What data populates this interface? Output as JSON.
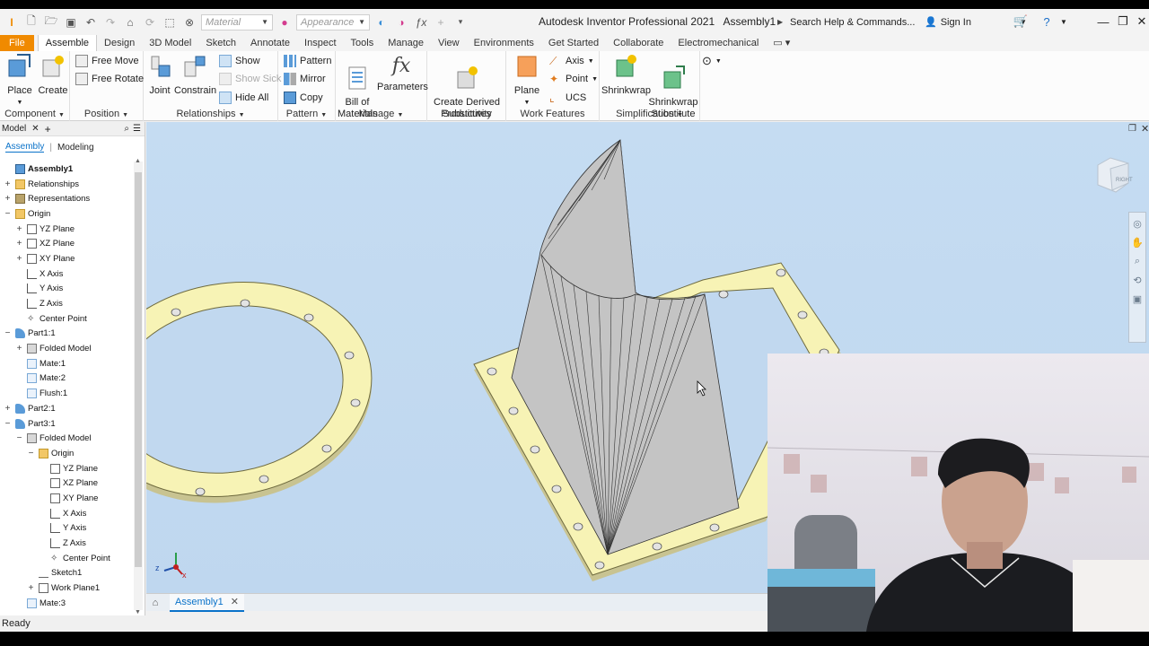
{
  "app": {
    "title": "Autodesk Inventor Professional 2021",
    "document": "Assembly1"
  },
  "qat": {
    "material_placeholder": "Material",
    "appearance_placeholder": "Appearance"
  },
  "search": {
    "placeholder": "Search Help & Commands..."
  },
  "account": {
    "sign_in": "Sign In"
  },
  "menu_tabs": [
    "File",
    "Assemble",
    "Design",
    "3D Model",
    "Sketch",
    "Annotate",
    "Inspect",
    "Tools",
    "Manage",
    "View",
    "Environments",
    "Get Started",
    "Collaborate",
    "Electromechanical"
  ],
  "ribbon": {
    "component": {
      "title": "Component",
      "place": "Place",
      "create": "Create"
    },
    "position": {
      "title": "Position",
      "free_move": "Free Move",
      "free_rotate": "Free Rotate"
    },
    "relationships": {
      "title": "Relationships",
      "joint": "Joint",
      "constrain": "Constrain",
      "show": "Show",
      "show_sick": "Show Sick",
      "hide_all": "Hide All"
    },
    "pattern": {
      "title": "Pattern",
      "pattern": "Pattern",
      "mirror": "Mirror",
      "copy": "Copy"
    },
    "manage": {
      "title": "Manage",
      "bom": "Bill of\nMaterials",
      "parameters": "Parameters"
    },
    "productivity": {
      "title": "Productivity",
      "derived": "Create Derived\nSubstitutes"
    },
    "work_features": {
      "title": "Work Features",
      "plane": "Plane",
      "axis": "Axis",
      "point": "Point",
      "ucs": "UCS"
    },
    "simplification": {
      "title": "Simplification",
      "shrinkwrap": "Shrinkwrap",
      "shrinkwrap_sub": "Shrinkwrap\nSubstitute"
    }
  },
  "browser": {
    "header": "Model",
    "tabs": [
      "Assembly",
      "Modeling"
    ],
    "tree": [
      {
        "label": "Assembly1",
        "level": 0,
        "pm": "",
        "icon": "assembly-icon",
        "bold": true
      },
      {
        "label": "Relationships",
        "level": 0,
        "pm": "+",
        "icon": "folder-icon"
      },
      {
        "label": "Representations",
        "level": 0,
        "pm": "+",
        "icon": "representations-icon"
      },
      {
        "label": "Origin",
        "level": 0,
        "pm": "−",
        "icon": "folder-icon"
      },
      {
        "label": "YZ Plane",
        "level": 1,
        "pm": "+",
        "icon": "plane-icon"
      },
      {
        "label": "XZ Plane",
        "level": 1,
        "pm": "+",
        "icon": "plane-icon"
      },
      {
        "label": "XY Plane",
        "level": 1,
        "pm": "+",
        "icon": "plane-icon"
      },
      {
        "label": "X Axis",
        "level": 1,
        "pm": "",
        "icon": "axis-icon"
      },
      {
        "label": "Y Axis",
        "level": 1,
        "pm": "",
        "icon": "axis-icon"
      },
      {
        "label": "Z Axis",
        "level": 1,
        "pm": "",
        "icon": "axis-icon"
      },
      {
        "label": "Center Point",
        "level": 1,
        "pm": "",
        "icon": "point-icon"
      },
      {
        "label": "Part1:1",
        "level": 0,
        "pm": "−",
        "icon": "part-icon"
      },
      {
        "label": "Folded Model",
        "level": 1,
        "pm": "+",
        "icon": "folded-model-icon"
      },
      {
        "label": "Mate:1",
        "level": 1,
        "pm": "",
        "icon": "mate-icon"
      },
      {
        "label": "Mate:2",
        "level": 1,
        "pm": "",
        "icon": "mate-icon"
      },
      {
        "label": "Flush:1",
        "level": 1,
        "pm": "",
        "icon": "flush-icon"
      },
      {
        "label": "Part2:1",
        "level": 0,
        "pm": "+",
        "icon": "part-icon"
      },
      {
        "label": "Part3:1",
        "level": 0,
        "pm": "−",
        "icon": "part-icon"
      },
      {
        "label": "Folded Model",
        "level": 1,
        "pm": "−",
        "icon": "folded-model-icon"
      },
      {
        "label": "Origin",
        "level": 2,
        "pm": "−",
        "icon": "folder-icon"
      },
      {
        "label": "YZ Plane",
        "level": 3,
        "pm": "",
        "icon": "plane-icon"
      },
      {
        "label": "XZ Plane",
        "level": 3,
        "pm": "",
        "icon": "plane-icon"
      },
      {
        "label": "XY Plane",
        "level": 3,
        "pm": "",
        "icon": "plane-icon"
      },
      {
        "label": "X Axis",
        "level": 3,
        "pm": "",
        "icon": "axis-icon"
      },
      {
        "label": "Y Axis",
        "level": 3,
        "pm": "",
        "icon": "axis-icon"
      },
      {
        "label": "Z Axis",
        "level": 3,
        "pm": "",
        "icon": "axis-icon"
      },
      {
        "label": "Center Point",
        "level": 3,
        "pm": "",
        "icon": "point-icon"
      },
      {
        "label": "Sketch1",
        "level": 2,
        "pm": "",
        "icon": "sketch-icon"
      },
      {
        "label": "Work Plane1",
        "level": 2,
        "pm": "+",
        "icon": "plane-icon"
      },
      {
        "label": "Mate:3",
        "level": 1,
        "pm": "",
        "icon": "mate-icon"
      }
    ]
  },
  "viewcube": {
    "face": "RIGHT"
  },
  "document_tabs": [
    "Assembly1"
  ],
  "status": "Ready",
  "colors": {
    "file_tab": "#f08a00",
    "accent": "#0a72c9",
    "flange": "#f7f3b5",
    "sheet": "#c4c4c4"
  }
}
